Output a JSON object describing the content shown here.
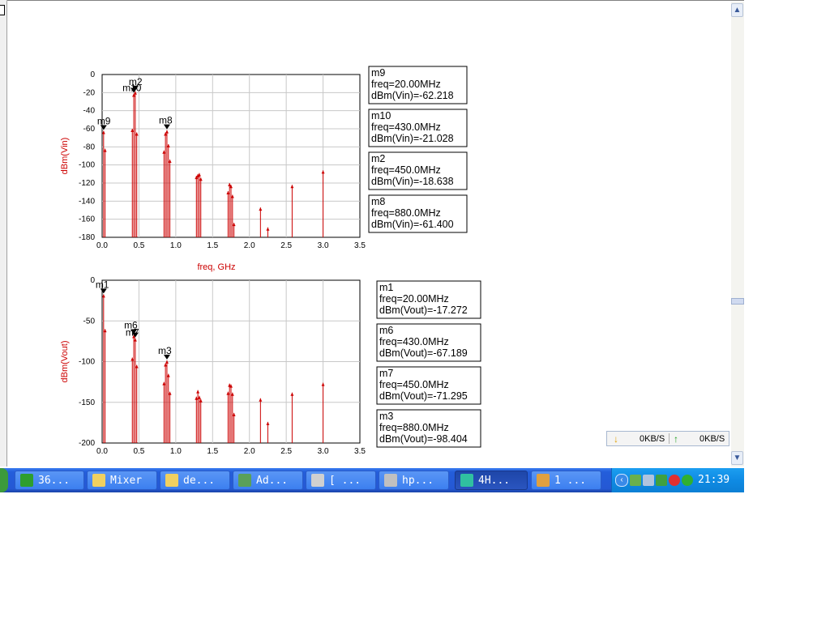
{
  "chart_data": [
    {
      "type": "spectrum",
      "title": "",
      "xlabel": "freq, GHz",
      "ylabel": "dBm(Vin)",
      "xlim": [
        0,
        3.5
      ],
      "ylim": [
        -180,
        0
      ],
      "xticks": [
        "0.0",
        "0.5",
        "1.0",
        "1.5",
        "2.0",
        "2.5",
        "3.0",
        "3.5"
      ],
      "yticks": [
        "0",
        "-20",
        "-40",
        "-60",
        "-80",
        "-100",
        "-120",
        "-140",
        "-160",
        "-180"
      ],
      "grid": true,
      "series": [
        {
          "points": [
            {
              "x": 0.02,
              "y": -62.2
            },
            {
              "x": 0.04,
              "y": -82
            },
            {
              "x": 0.41,
              "y": -60
            },
            {
              "x": 0.43,
              "y": -21.0
            },
            {
              "x": 0.45,
              "y": -18.6
            },
            {
              "x": 0.47,
              "y": -64
            },
            {
              "x": 0.84,
              "y": -84
            },
            {
              "x": 0.86,
              "y": -64
            },
            {
              "x": 0.88,
              "y": -61.4
            },
            {
              "x": 0.9,
              "y": -77
            },
            {
              "x": 0.92,
              "y": -94
            },
            {
              "x": 1.28,
              "y": -112
            },
            {
              "x": 1.3,
              "y": -110
            },
            {
              "x": 1.32,
              "y": -109
            },
            {
              "x": 1.34,
              "y": -114
            },
            {
              "x": 1.71,
              "y": -129
            },
            {
              "x": 1.73,
              "y": -120
            },
            {
              "x": 1.75,
              "y": -122
            },
            {
              "x": 1.77,
              "y": -133
            },
            {
              "x": 1.79,
              "y": -164
            },
            {
              "x": 2.15,
              "y": -147
            },
            {
              "x": 2.25,
              "y": -169
            },
            {
              "x": 2.58,
              "y": -122
            },
            {
              "x": 3.0,
              "y": -106
            }
          ]
        }
      ],
      "markers": [
        {
          "name": "m9",
          "freq": "freq=20.00MHz",
          "value": "dBm(Vin)=-62.218",
          "x": 0.02,
          "y": -62.2
        },
        {
          "name": "m10",
          "freq": "freq=430.0MHz",
          "value": "dBm(Vin)=-21.028",
          "x": 0.43,
          "y": -21.0
        },
        {
          "name": "m2",
          "freq": "freq=450.0MHz",
          "value": "dBm(Vin)=-18.638",
          "x": 0.45,
          "y": -18.6
        },
        {
          "name": "m8",
          "freq": "freq=880.0MHz",
          "value": "dBm(Vin)=-61.400",
          "x": 0.88,
          "y": -61.4
        }
      ]
    },
    {
      "type": "spectrum",
      "title": "",
      "xlabel": "",
      "ylabel": "dBm(Vout)",
      "xlim": [
        0,
        3.5
      ],
      "ylim": [
        -200,
        0
      ],
      "xticks": [
        "0.0",
        "0.5",
        "1.0",
        "1.5",
        "2.0",
        "2.5",
        "3.0",
        "3.5"
      ],
      "yticks": [
        "0",
        "-50",
        "-100",
        "-150",
        "-200"
      ],
      "grid": true,
      "series": [
        {
          "points": [
            {
              "x": 0.02,
              "y": -17.3
            },
            {
              "x": 0.04,
              "y": -60
            },
            {
              "x": 0.41,
              "y": -95
            },
            {
              "x": 0.43,
              "y": -67.2
            },
            {
              "x": 0.45,
              "y": -71.3
            },
            {
              "x": 0.47,
              "y": -104
            },
            {
              "x": 0.84,
              "y": -125
            },
            {
              "x": 0.86,
              "y": -102
            },
            {
              "x": 0.88,
              "y": -98.4
            },
            {
              "x": 0.9,
              "y": -115
            },
            {
              "x": 0.92,
              "y": -137
            },
            {
              "x": 1.28,
              "y": -143
            },
            {
              "x": 1.3,
              "y": -135
            },
            {
              "x": 1.32,
              "y": -142
            },
            {
              "x": 1.34,
              "y": -146
            },
            {
              "x": 1.71,
              "y": -137
            },
            {
              "x": 1.73,
              "y": -127
            },
            {
              "x": 1.75,
              "y": -128
            },
            {
              "x": 1.77,
              "y": -138
            },
            {
              "x": 1.79,
              "y": -163
            },
            {
              "x": 2.15,
              "y": -145
            },
            {
              "x": 2.25,
              "y": -174
            },
            {
              "x": 2.58,
              "y": -138
            },
            {
              "x": 3.0,
              "y": -126
            }
          ]
        }
      ],
      "markers": [
        {
          "name": "m1",
          "freq": "freq=20.00MHz",
          "value": "dBm(Vout)=-17.272",
          "x": 0.02,
          "y": -17.3
        },
        {
          "name": "m6",
          "freq": "freq=430.0MHz",
          "value": "dBm(Vout)=-67.189",
          "x": 0.43,
          "y": -67.2
        },
        {
          "name": "m7",
          "freq": "freq=450.0MHz",
          "value": "dBm(Vout)=-71.295",
          "x": 0.45,
          "y": -71.3
        },
        {
          "name": "m3",
          "freq": "freq=880.0MHz",
          "value": "dBm(Vout)=-98.404",
          "x": 0.88,
          "y": -98.4
        }
      ]
    }
  ],
  "colors": {
    "trace": "#cc0000",
    "marker": "#000000",
    "grid": "#c8c8c8",
    "taskbar": "#245edb",
    "tray": "#0f8be4"
  },
  "netmeter": {
    "down": "0KB/S",
    "up": "0KB/S"
  },
  "taskbar": {
    "tasks": [
      {
        "label": "36...",
        "icon": "shield-icon",
        "color": "#2e9e2e"
      },
      {
        "label": "Mixer",
        "icon": "folder-icon",
        "color": "#f0d060"
      },
      {
        "label": "de...",
        "icon": "folder-icon",
        "color": "#f0d060"
      },
      {
        "label": "Ad...",
        "icon": "app-window-icon",
        "color": "#5aa05a"
      },
      {
        "label": "[ ...",
        "icon": "app-window-icon",
        "color": "#d0d0d0"
      },
      {
        "label": "hp...",
        "icon": "ads-icon",
        "color": "#c0c0c0"
      },
      {
        "label": "4H...",
        "icon": "grid-icon",
        "color": "#30c0a0"
      },
      {
        "label": "1 ...",
        "icon": "brush-icon",
        "color": "#e0a040"
      }
    ],
    "clock": "21:39"
  }
}
